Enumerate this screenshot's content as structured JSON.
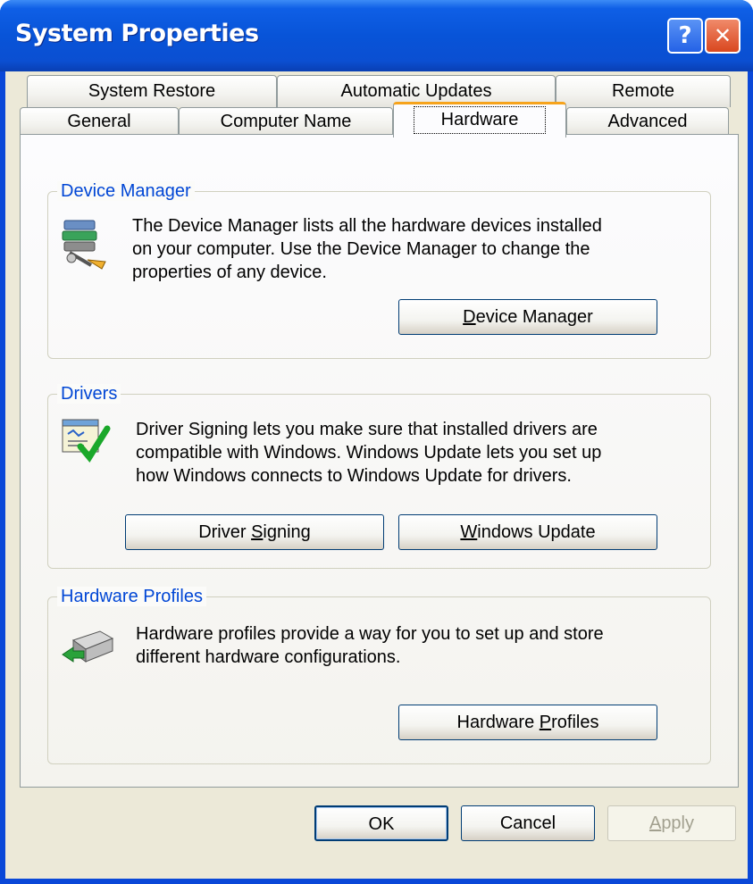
{
  "window": {
    "title": "System Properties"
  },
  "titlebar": {
    "help_label": "?",
    "close_label": "✕"
  },
  "tabs": {
    "top_row": [
      "System Restore",
      "Automatic Updates",
      "Remote"
    ],
    "bottom_row": [
      "General",
      "Computer Name",
      "Hardware",
      "Advanced"
    ],
    "active": "Hardware"
  },
  "device_manager": {
    "group_label": "Device Manager",
    "description_lines": [
      "The Device Manager lists all the hardware devices installed",
      "on your computer. Use the Device Manager to change the",
      "properties of any device."
    ],
    "button": {
      "mnemonic": "D",
      "rest": "evice Manager"
    },
    "icon": "device-manager-icon"
  },
  "drivers": {
    "group_label": "Drivers",
    "description_lines": [
      "Driver Signing lets you make sure that installed drivers are",
      "compatible with Windows. Windows Update lets you set up",
      "how Windows connects to Windows Update for drivers."
    ],
    "signing_button": {
      "before": "Driver ",
      "mnemonic": "S",
      "rest": "igning"
    },
    "update_button": {
      "mnemonic": "W",
      "rest": "indows Update"
    },
    "icon": "driver-signing-icon"
  },
  "hardware_profiles": {
    "group_label": "Hardware Profiles",
    "description_lines": [
      "Hardware profiles provide a way for you to set up and store",
      "different hardware configurations."
    ],
    "button": {
      "before": "Hardware ",
      "mnemonic": "P",
      "rest": "rofiles"
    },
    "icon": "hardware-profiles-icon"
  },
  "footer": {
    "ok": "OK",
    "cancel": "Cancel",
    "apply": {
      "mnemonic": "A",
      "rest": "pply"
    }
  },
  "colors": {
    "titlebar": "#0854d8",
    "group_label": "#0046d5",
    "active_tab_accent": "#f6a31c",
    "dialog_bg": "#ece9d8"
  }
}
